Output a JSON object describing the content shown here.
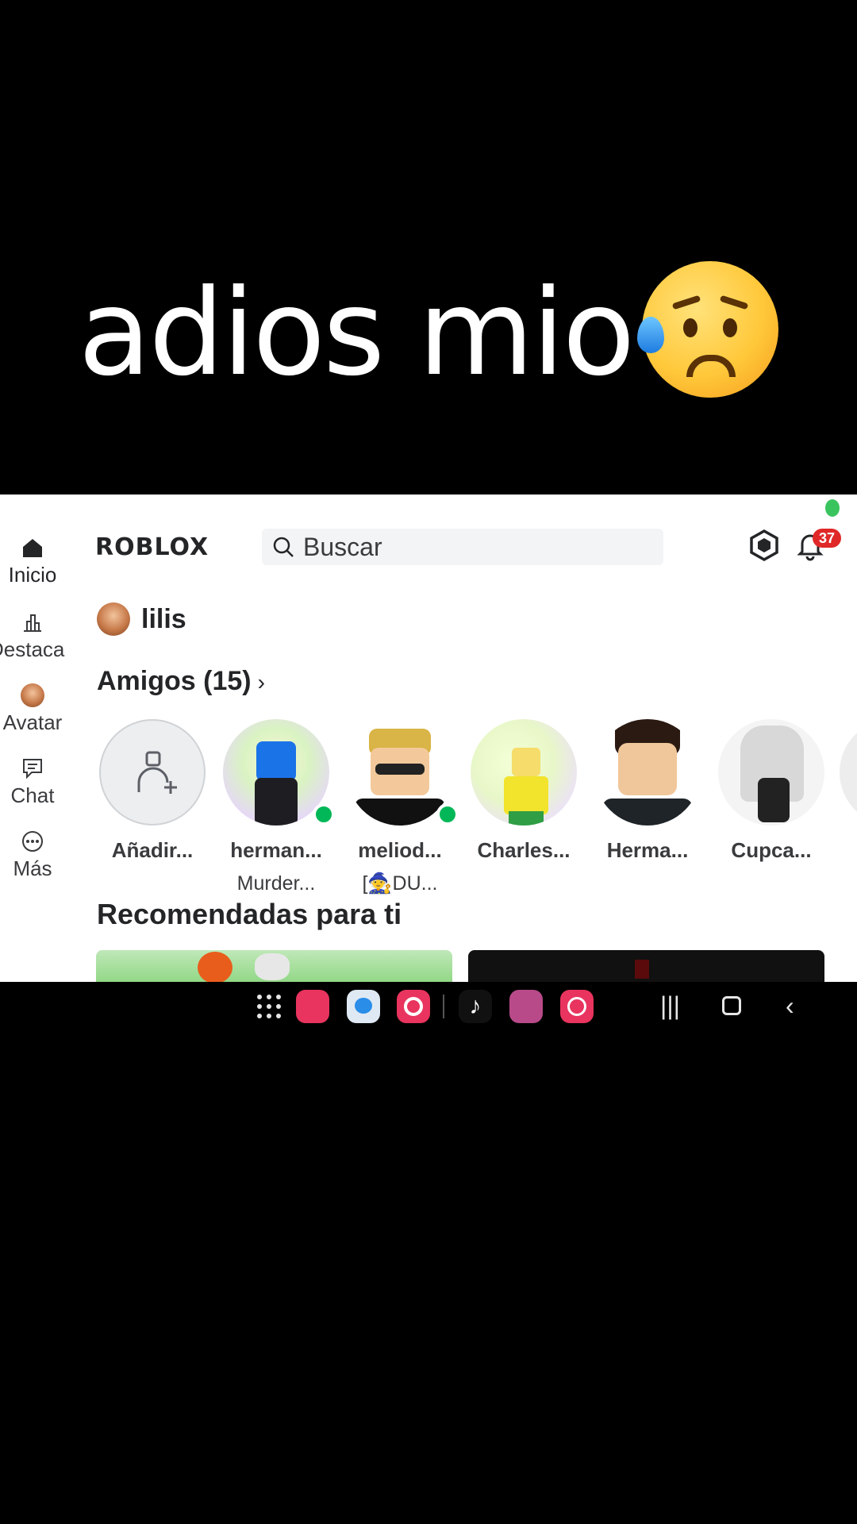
{
  "caption": {
    "text": "adios mio",
    "emoji": "sad-sweat-face-emoji"
  },
  "app": {
    "logo": "ROBLOX",
    "search": {
      "placeholder": "Buscar"
    },
    "notifications_count": "37",
    "nav": [
      {
        "label": "Inicio",
        "icon": "home-icon"
      },
      {
        "label": "Destacados",
        "icon": "charts-icon"
      },
      {
        "label": "Avatar",
        "icon": "avatar-icon"
      },
      {
        "label": "Chat",
        "icon": "chat-icon"
      },
      {
        "label": "Más",
        "icon": "more-icon"
      }
    ],
    "user": {
      "name": "lilis"
    },
    "friends": {
      "title": "Amigos (15)",
      "items": [
        {
          "name": "Añadir...",
          "sub": "",
          "online": false
        },
        {
          "name": "herman...",
          "sub": "Murder...",
          "online": true
        },
        {
          "name": "meliod...",
          "sub": "[🧙DU...",
          "online": true
        },
        {
          "name": "Charles...",
          "sub": "",
          "online": false
        },
        {
          "name": "Herma...",
          "sub": "",
          "online": false
        },
        {
          "name": "Cupca...",
          "sub": "",
          "online": false
        }
      ]
    },
    "recommended_title": "Recomendadas para ti",
    "colors": {
      "accent": "#02b757",
      "badge": "#e02828",
      "text": "#232527"
    }
  },
  "taskbar": {
    "apps": [
      "apps-grid-icon",
      "phone-app-icon",
      "messages-app-icon",
      "chrome-app-icon",
      "tiktok-app-icon",
      "games-folder-icon",
      "whatsapp-app-icon"
    ],
    "system": [
      "recents-icon",
      "home-button-icon",
      "back-icon"
    ]
  }
}
